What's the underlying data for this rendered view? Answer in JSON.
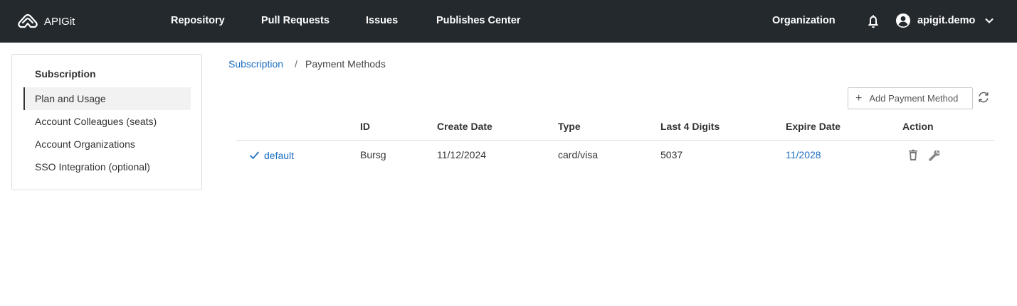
{
  "app": {
    "name": "APIGit"
  },
  "nav": {
    "items": [
      {
        "label": "Repository"
      },
      {
        "label": "Pull Requests"
      },
      {
        "label": "Issues"
      },
      {
        "label": "Publishes Center"
      }
    ],
    "organization": "Organization",
    "username": "apigit.demo"
  },
  "sidebar": {
    "title": "Subscription",
    "items": [
      {
        "label": "Plan and Usage",
        "active": true
      },
      {
        "label": "Account Colleagues (seats)"
      },
      {
        "label": "Account Organizations"
      },
      {
        "label": "SSO Integration (optional)"
      }
    ]
  },
  "breadcrumb": {
    "parent": "Subscription",
    "separator": "/",
    "current": "Payment Methods"
  },
  "toolbar": {
    "add_label": "Add Payment Method",
    "add_icon": "plus-icon",
    "refresh_icon": "refresh-icon"
  },
  "table": {
    "columns": [
      "ID",
      "Create Date",
      "Type",
      "Last 4 Digits",
      "Expire Date",
      "Action"
    ],
    "rows": [
      {
        "default_label": "default",
        "id": "Bursg",
        "create_date": "11/12/2024",
        "type": "card/visa",
        "last4": "5037",
        "expire": "11/2028",
        "actions": [
          "delete-icon",
          "wrench-icon"
        ]
      }
    ]
  },
  "colors": {
    "topbar": "#24292e",
    "link": "#1e6fc2",
    "border": "#dcdcdc"
  }
}
